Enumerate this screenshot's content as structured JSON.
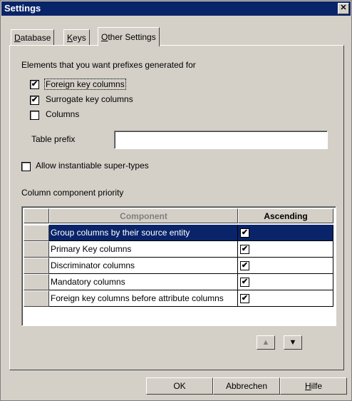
{
  "window": {
    "title": "Settings",
    "close_glyph": "✕"
  },
  "tabs": [
    {
      "label_u": "D",
      "label_rest": "atabase",
      "active": false
    },
    {
      "label_u": "K",
      "label_rest": "eys",
      "active": false
    },
    {
      "label_u": "O",
      "label_rest": "ther Settings",
      "active": true
    }
  ],
  "prefixes": {
    "heading": "Elements that you want prefixes generated for",
    "options": [
      {
        "label": "Foreign key columns",
        "checked": true
      },
      {
        "label": "Surrogate key columns",
        "checked": true
      },
      {
        "label": "Columns",
        "checked": false
      }
    ],
    "table_prefix_label": "Table prefix",
    "table_prefix_value": ""
  },
  "allow_instantiable": {
    "label": "Allow instantiable super-types",
    "checked": false
  },
  "priority": {
    "heading": "Column component priority",
    "columns": {
      "component": "Component",
      "ascending": "Ascending"
    },
    "rows": [
      {
        "component": "Group columns by their source entity",
        "ascending": true,
        "selected": true
      },
      {
        "component": "Primary Key columns",
        "ascending": true,
        "selected": false
      },
      {
        "component": "Discriminator columns",
        "ascending": true,
        "selected": false
      },
      {
        "component": "Mandatory columns",
        "ascending": true,
        "selected": false
      },
      {
        "component": "Foreign key columns before attribute columns",
        "ascending": true,
        "selected": false
      }
    ],
    "move_up_icon": "triangle-up-icon",
    "move_down_icon": "triangle-down-icon"
  },
  "buttons": {
    "ok": "OK",
    "cancel": "Abbrechen",
    "help_u": "H",
    "help_rest": "ilfe"
  },
  "colors": {
    "selection": "#0a246a",
    "titlebar": "#0a246a",
    "face": "#d4d0c8"
  }
}
